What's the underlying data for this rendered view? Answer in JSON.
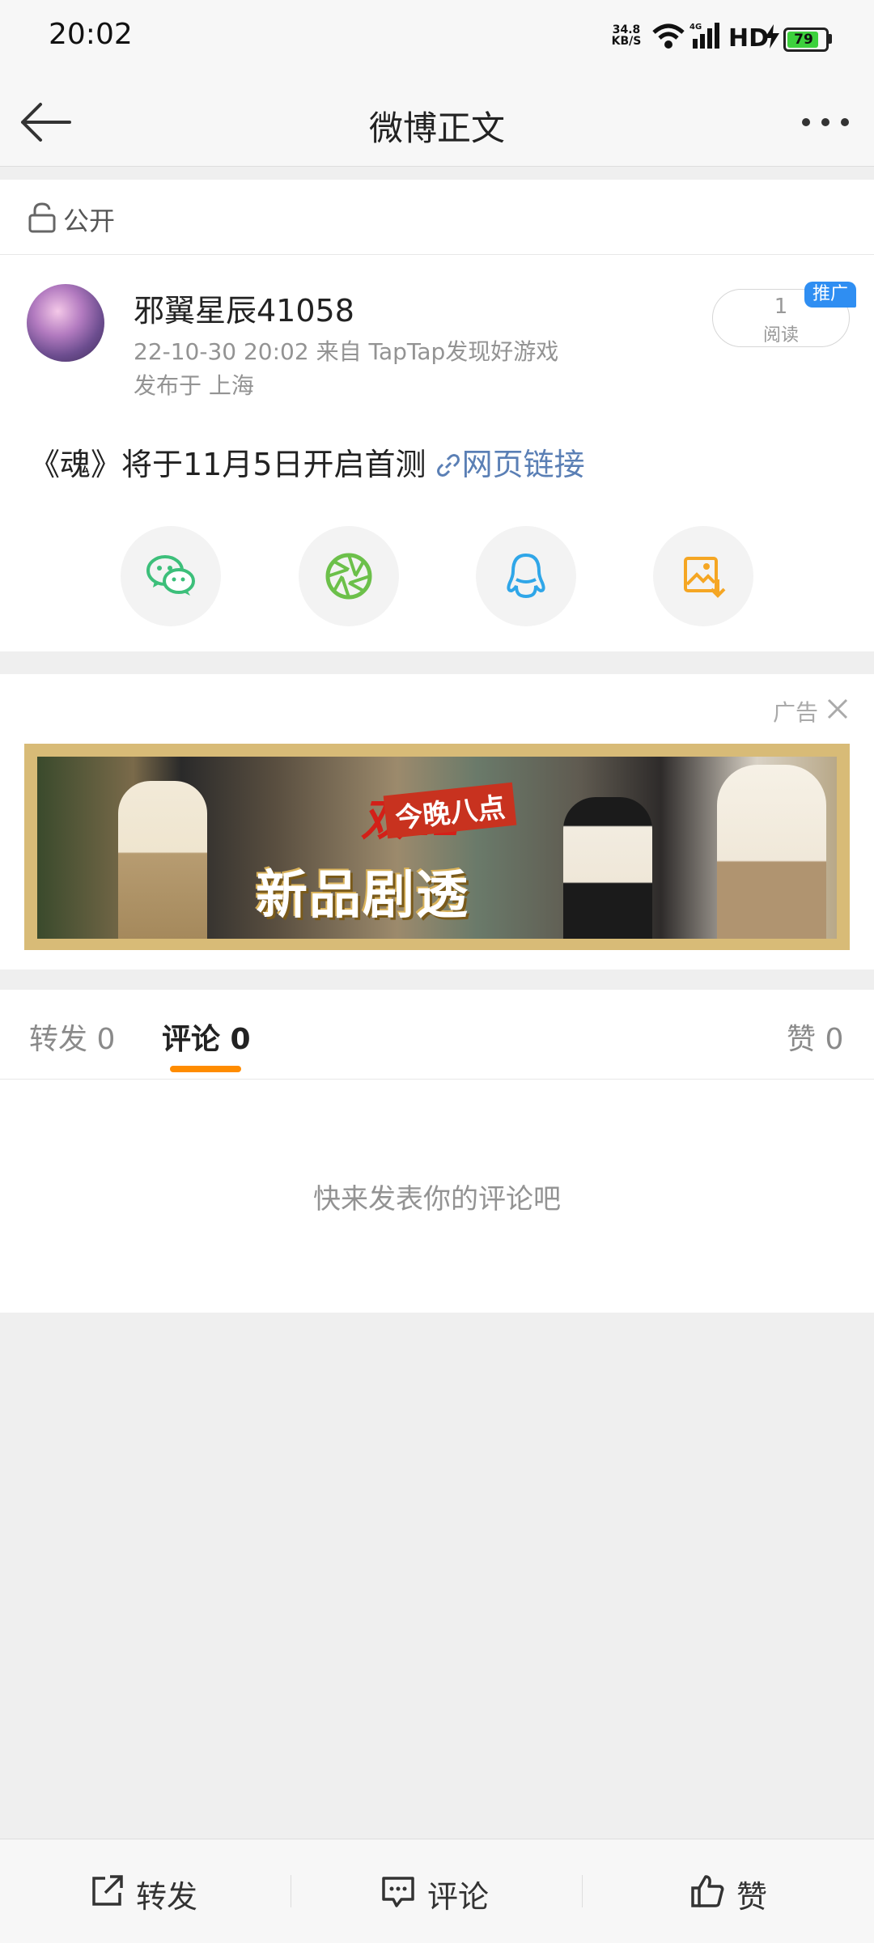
{
  "status_bar": {
    "time": "20:02",
    "net_speed_value": "34.8",
    "net_speed_unit": "KB/S",
    "network_type": "4G",
    "hd_label": "HD",
    "battery": "79"
  },
  "header": {
    "title": "微博正文"
  },
  "visibility": {
    "label": "公开"
  },
  "post": {
    "username": "邪翼星辰41058",
    "meta": "22-10-30 20:02   来自 TapTap发现好游戏",
    "location": "发布于 上海",
    "read_count": "1",
    "read_label": "阅读",
    "promo_badge": "推广",
    "content_text": "《魂》将于11月5日开启首测 ",
    "link_text": "网页链接"
  },
  "share_icons": [
    "wechat-icon",
    "moments-icon",
    "qq-icon",
    "save-image-icon"
  ],
  "ad": {
    "label": "广告",
    "banner_text_1": "双11",
    "banner_text_2": "今晚八点",
    "banner_text_3": "新品剧透"
  },
  "tabs": {
    "repost": "转发 0",
    "comment": "评论 0",
    "like": "赞 0"
  },
  "comments": {
    "empty_text": "快来发表你的评论吧"
  },
  "bottom_bar": {
    "repost": "转发",
    "comment": "评论",
    "like": "赞"
  },
  "colors": {
    "accent": "#ff8c00",
    "link": "#5a7fb5",
    "promo_badge": "#2f8ef2"
  }
}
